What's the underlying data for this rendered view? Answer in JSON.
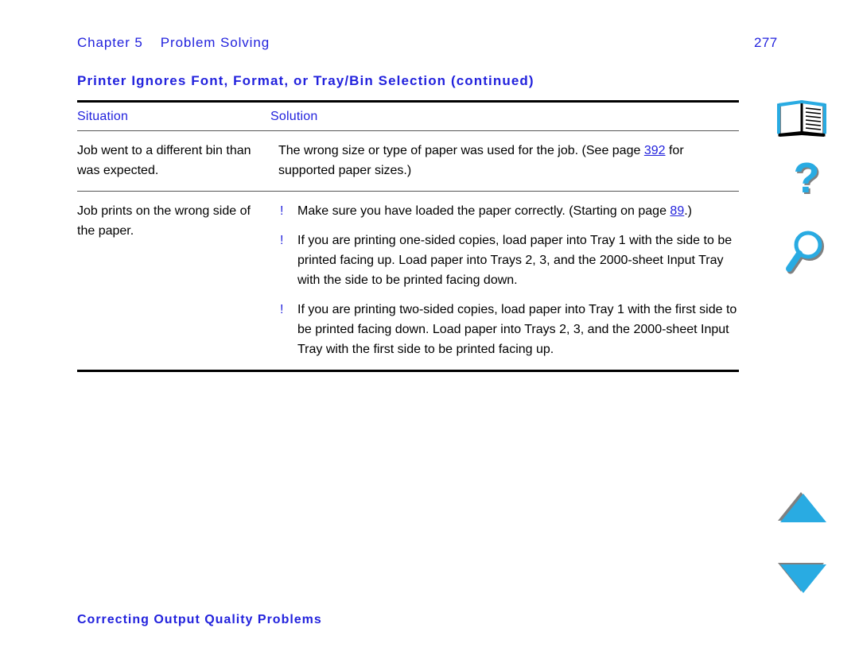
{
  "document": {
    "running_head": {
      "chapter_label": "Chapter 5",
      "chapter_title": "Problem Solving"
    },
    "page_number": "277",
    "table_title": "Printer Ignores Font, Format, or Tray/Bin Selection (continued)",
    "section_heading": "Correcting Output Quality Problems"
  },
  "colors": {
    "heading_blue": "#2222dd",
    "link_blue": "#2222dd",
    "icon_cyan": "#29abe2",
    "icon_shadow_gray": "#808080",
    "rule_black": "#000000"
  },
  "table": {
    "headers": {
      "situation": "Situation",
      "solution": "Solution"
    },
    "rows": [
      {
        "situation": "Job went to a different bin than was expected.",
        "solution_intro_before": "The wrong size or type of paper was used for the job. (See page ",
        "solution_link": "392",
        "solution_intro_after": " for supported paper sizes.)",
        "bullets": []
      },
      {
        "situation": "Job prints on the wrong side of the paper.",
        "bullets": [
          {
            "bullet_glyph": "!",
            "text_before": "Make sure you have loaded the paper correctly. (Starting on page ",
            "link": "89",
            "text_after": ".)"
          },
          {
            "bullet_glyph": "!",
            "text_before": "If you are printing one-sided copies, load paper into Tray 1 with the side to be printed facing up. Load paper into Trays 2, 3, and the 2000-sheet Input Tray with the side to be printed facing down.",
            "link": "",
            "text_after": ""
          },
          {
            "bullet_glyph": "!",
            "text_before": "If you are printing two-sided copies, load paper into Tray 1 with the first side to be printed facing down. Load paper into Trays 2, 3, and the 2000-sheet Input Tray with the first side to be printed facing up.",
            "link": "",
            "text_after": ""
          }
        ]
      }
    ]
  },
  "nav_icons": [
    {
      "name": "book-icon",
      "label": "Contents"
    },
    {
      "name": "question-mark-icon",
      "label": "Help"
    },
    {
      "name": "magnifier-icon",
      "label": "Search"
    },
    {
      "name": "triangle-up-icon",
      "label": "Previous page"
    },
    {
      "name": "triangle-down-icon",
      "label": "Next page"
    }
  ]
}
